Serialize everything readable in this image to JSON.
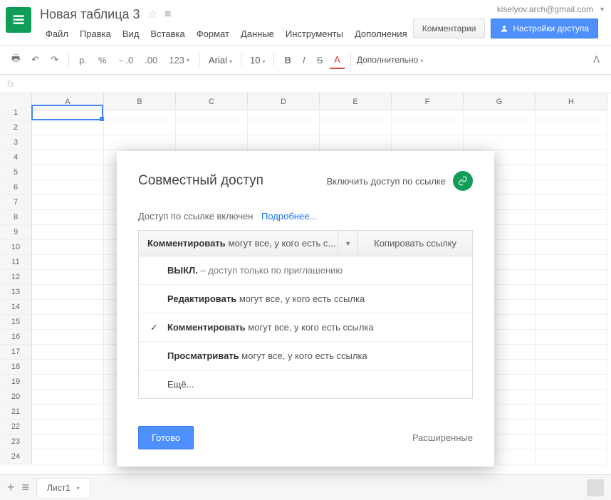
{
  "header": {
    "title": "Новая таблица 3",
    "user_email": "kiselyov.arch@gmail.com"
  },
  "menu": {
    "file": "Файл",
    "edit": "Правка",
    "view": "Вид",
    "insert": "Вставка",
    "format": "Формат",
    "data": "Данные",
    "tools": "Инструменты",
    "addons": "Дополнения",
    "comments": "Комментарии",
    "share": "Настройки доступа"
  },
  "toolbar": {
    "currency": "р.",
    "percent": "%",
    "dec_dec": ".0",
    "dec_inc": ".00",
    "num": "123",
    "font": "Arial",
    "size": "10",
    "bold": "B",
    "italic": "I",
    "strike": "S",
    "underline": "A",
    "more": "Дополнительно"
  },
  "columns": [
    "A",
    "B",
    "C",
    "D",
    "E",
    "F",
    "G",
    "H"
  ],
  "rows": [
    "1",
    "2",
    "3",
    "4",
    "5",
    "6",
    "7",
    "8",
    "9",
    "10",
    "11",
    "12",
    "13",
    "14",
    "15",
    "16",
    "17",
    "18",
    "19",
    "20",
    "21",
    "22",
    "23",
    "24"
  ],
  "sheet": {
    "tab": "Лист1"
  },
  "modal": {
    "title": "Совместный доступ",
    "link_toggle": "Включить доступ по ссылке",
    "link_enabled": "Доступ по ссылке включен",
    "learn_more": "Подробнее...",
    "select_strong": "Комментировать",
    "select_rest": "могут все, у кого есть с...",
    "copy_link": "Копировать ссылку",
    "opt_off_strong": "ВЫКЛ.",
    "opt_off_rest": " – доступ только по приглашению",
    "opt_edit_strong": "Редактировать",
    "opt_edit_rest": " могут все, у кого есть ссылка",
    "opt_comment_strong": "Комментировать",
    "opt_comment_rest": " могут все, у кого есть ссылка",
    "opt_view_strong": "Просматривать",
    "opt_view_rest": " могут все, у кого есть ссылка",
    "opt_more": "Ещё...",
    "done": "Готово",
    "advanced": "Расширенные"
  }
}
